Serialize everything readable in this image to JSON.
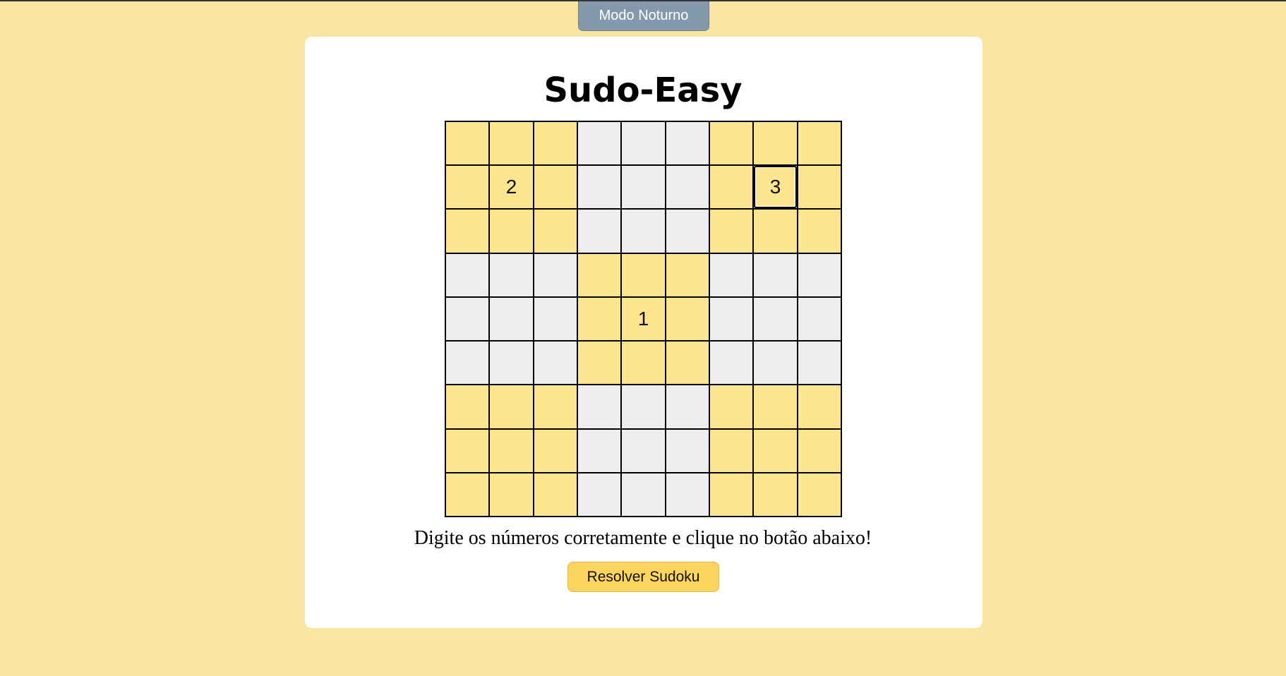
{
  "header": {
    "night_mode_label": "Modo Noturno"
  },
  "main": {
    "title": "Sudo-Easy",
    "instructions": "Digite os números corretamente e clique no botão abaixo!",
    "solve_label": "Resolver Sudoku"
  },
  "colors": {
    "page_background": "#f9e6a0",
    "yellow_box": "#fde48f",
    "gray_box": "#eeeeee",
    "night_button": "#8499ab",
    "solve_button": "#fbd55e"
  },
  "sudoku": {
    "focused_cell": [
      1,
      7
    ],
    "rows": [
      [
        "",
        "",
        "",
        "",
        "",
        "",
        "",
        "",
        ""
      ],
      [
        "",
        "2",
        "",
        "",
        "",
        "",
        "",
        "3",
        ""
      ],
      [
        "",
        "",
        "",
        "",
        "",
        "",
        "",
        "",
        ""
      ],
      [
        "",
        "",
        "",
        "",
        "",
        "",
        "",
        "",
        ""
      ],
      [
        "",
        "",
        "",
        "",
        "1",
        "",
        "",
        "",
        ""
      ],
      [
        "",
        "",
        "",
        "",
        "",
        "",
        "",
        "",
        ""
      ],
      [
        "",
        "",
        "",
        "",
        "",
        "",
        "",
        "",
        ""
      ],
      [
        "",
        "",
        "",
        "",
        "",
        "",
        "",
        "",
        ""
      ],
      [
        "",
        "",
        "",
        "",
        "",
        "",
        "",
        "",
        ""
      ]
    ]
  }
}
